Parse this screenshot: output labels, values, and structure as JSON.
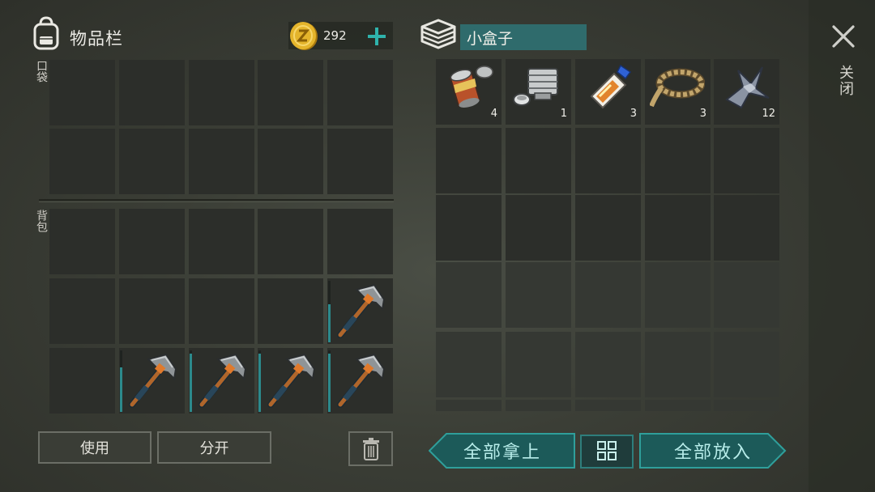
{
  "inventory": {
    "title": "物品栏",
    "coins": "292",
    "pocket_label": "口袋",
    "backpack_label": "背包",
    "backpack_items": [
      {
        "row": 1,
        "col": 4,
        "icon": "pickaxe-icon",
        "durability": 0.62
      },
      {
        "row": 2,
        "col": 1,
        "icon": "pickaxe-icon",
        "durability": 0.72
      },
      {
        "row": 2,
        "col": 2,
        "icon": "pickaxe-icon",
        "durability": 0.95
      },
      {
        "row": 2,
        "col": 3,
        "icon": "pickaxe-icon",
        "durability": 0.95
      },
      {
        "row": 2,
        "col": 4,
        "icon": "pickaxe-icon",
        "durability": 0.95
      }
    ],
    "use_label": "使用",
    "split_label": "分开"
  },
  "container": {
    "name": "小盒子",
    "items": [
      {
        "icon": "canned-food-icon",
        "qty": "4"
      },
      {
        "icon": "engine-part-icon",
        "qty": "1"
      },
      {
        "icon": "glue-icon",
        "qty": "3"
      },
      {
        "icon": "rope-icon",
        "qty": "3"
      },
      {
        "icon": "metal-scrap-icon",
        "qty": "12"
      }
    ],
    "take_all_label": "全部拿上",
    "put_all_label": "全部放入"
  },
  "close_label": "关闭",
  "colors": {
    "accent": "#2f6b6c",
    "button_teal": "#1c5a59",
    "coin": "#d9a726"
  }
}
